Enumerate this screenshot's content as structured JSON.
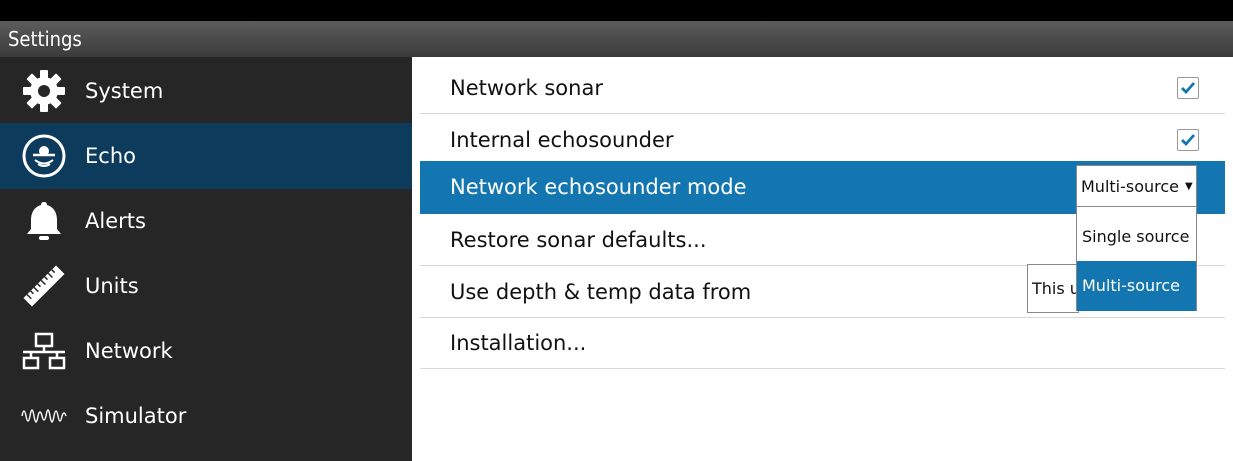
{
  "window": {
    "title": "Settings"
  },
  "sidebar": {
    "items": [
      {
        "label": "System",
        "icon": "gear-icon"
      },
      {
        "label": "Echo",
        "icon": "sonar-icon",
        "active": true
      },
      {
        "label": "Alerts",
        "icon": "bell-icon"
      },
      {
        "label": "Units",
        "icon": "ruler-icon"
      },
      {
        "label": "Network",
        "icon": "network-icon"
      },
      {
        "label": "Simulator",
        "icon": "waveform-icon"
      }
    ]
  },
  "main": {
    "rows": [
      {
        "label": "Network sonar",
        "checked": true
      },
      {
        "label": "Internal echosounder",
        "checked": true
      },
      {
        "label": "Network echosounder mode",
        "value": "Multi-source"
      },
      {
        "label": "Restore sonar defaults..."
      },
      {
        "label": "Use depth & temp data from",
        "value": "This ur"
      },
      {
        "label": "Installation..."
      }
    ]
  },
  "dropdown": {
    "options": [
      "Single source",
      "Multi-source"
    ],
    "selected": "Multi-source"
  },
  "colors": {
    "accent": "#1476b0",
    "sidebar_active": "#0d3b5c",
    "sidebar_bg": "#262626"
  }
}
